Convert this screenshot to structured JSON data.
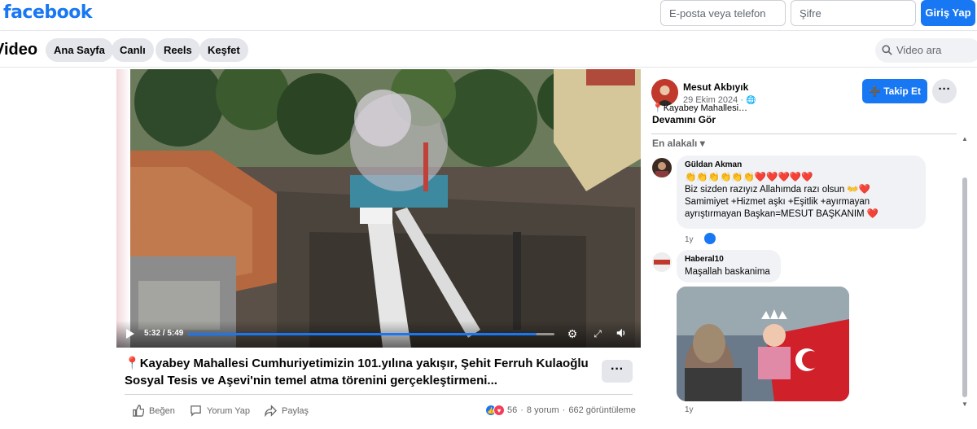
{
  "header": {
    "logo": "facebook",
    "email_placeholder": "E-posta veya telefon",
    "password_placeholder": "Şifre",
    "login_label": "Giriş Yap"
  },
  "nav": {
    "title": "Video",
    "tabs": [
      {
        "label": "Ana Sayfa"
      },
      {
        "label": "Canlı"
      },
      {
        "label": "Reels"
      },
      {
        "label": "Keşfet"
      }
    ],
    "search_placeholder": "Video ara"
  },
  "player": {
    "time": "5:32 / 5:49",
    "progress": 0.95
  },
  "post": {
    "caption_icon": "📍",
    "caption": "Kayabey Mahallesi Cumhuriyetimizin 101.yılına yakışır, Şehit Ferruh Kulaoğlu Sosyal Tesis ve Aşevi'nin temel atma törenini gerçekleştirmeni...",
    "actions": {
      "like": "Beğen",
      "comment": "Yorum Yap",
      "share": "Paylaş"
    },
    "stats": {
      "reactions": "56",
      "comments": "8 yorum",
      "views": "662 görüntüleme",
      "sep": "·"
    }
  },
  "side": {
    "author": "Mesut Akbıyık",
    "date": "29 Ekim 2024 ·",
    "follow_label": "Takip Et",
    "snippet": "📍Kayabey Mahallesi…",
    "see_more": "Devamını Gör",
    "sort_label": "En alakalı",
    "comments": [
      {
        "name": "Güldan Akman",
        "lines": [
          "👏👏👏👏👏👏❤️❤️❤️❤️❤️",
          "Biz sizden razıyız Allahımda razı olsun 👐❤️",
          "Samimiyet +Hizmet aşkı +Eşitlik +ayırmayan",
          "ayrıştırmayan Başkan=MESUT BAŞKANIM ❤️"
        ],
        "age": "1y"
      },
      {
        "name": "Haberal10",
        "lines": [
          "Maşallah baskanima"
        ],
        "age": "1y"
      }
    ]
  },
  "colors": {
    "accent": "#1877f2",
    "heart": "#f33e58"
  }
}
